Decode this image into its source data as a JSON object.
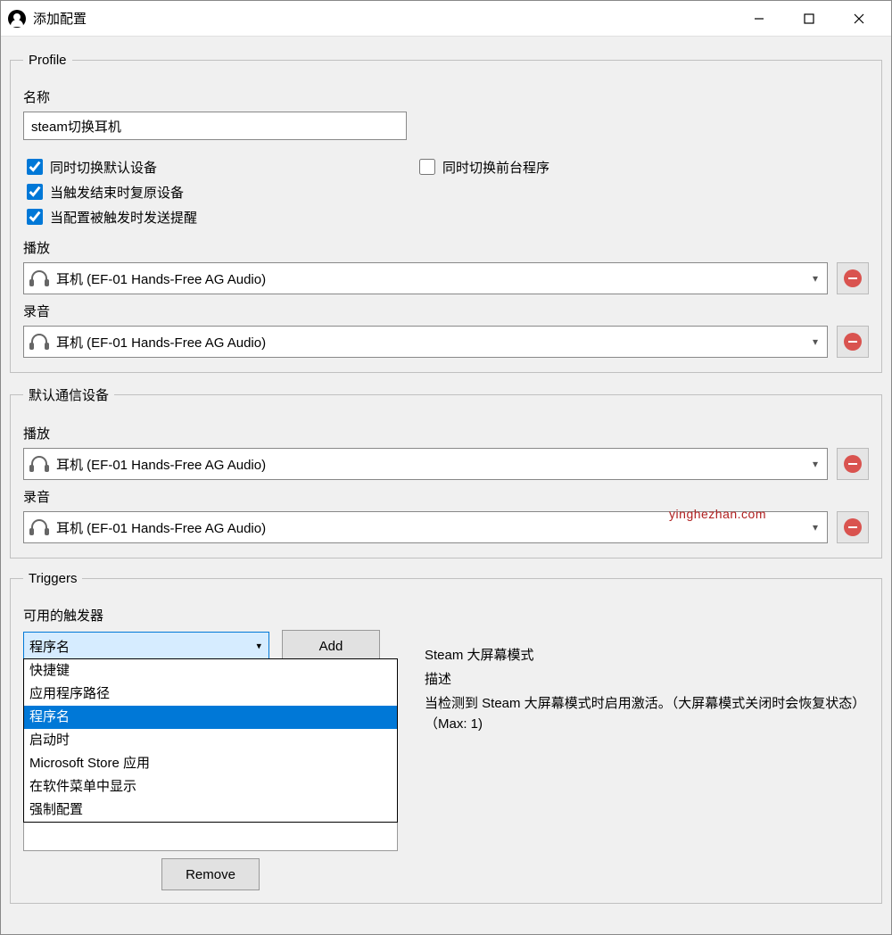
{
  "window": {
    "title": "添加配置"
  },
  "profile": {
    "legend": "Profile",
    "name_label": "名称",
    "name_value": "steam切换耳机",
    "checks": {
      "switch_default": {
        "label": "同时切换默认设备",
        "checked": true
      },
      "switch_foreground": {
        "label": "同时切换前台程序",
        "checked": false
      },
      "restore_on_end": {
        "label": "当触发结束时复原设备",
        "checked": true
      },
      "send_notify": {
        "label": "当配置被触发时发送提醒",
        "checked": true
      }
    },
    "playback_label": "播放",
    "playback_device": "耳机 (EF-01 Hands-Free AG Audio)",
    "recording_label": "录音",
    "recording_device": "耳机 (EF-01 Hands-Free AG Audio)"
  },
  "comm": {
    "legend": "默认通信设备",
    "playback_label": "播放",
    "playback_device": "耳机 (EF-01 Hands-Free AG Audio)",
    "recording_label": "录音",
    "recording_device": "耳机 (EF-01 Hands-Free AG Audio)"
  },
  "triggers": {
    "legend": "Triggers",
    "available_label": "可用的触发器",
    "select_value": "程序名",
    "options": [
      "快捷键",
      "应用程序路径",
      "程序名",
      "启动时",
      "Microsoft Store 应用",
      "在软件菜单中显示",
      "强制配置"
    ],
    "selected_option": "程序名",
    "add_label": "Add",
    "remove_label": "Remove",
    "detail": {
      "title": "Steam 大屏幕模式",
      "desc_label": "描述",
      "desc_body": "当检测到 Steam 大屏幕模式时启用激活。（大屏幕模式关闭时会恢复状态）（Max: 1)"
    }
  },
  "watermark": "yinghezhan.com"
}
